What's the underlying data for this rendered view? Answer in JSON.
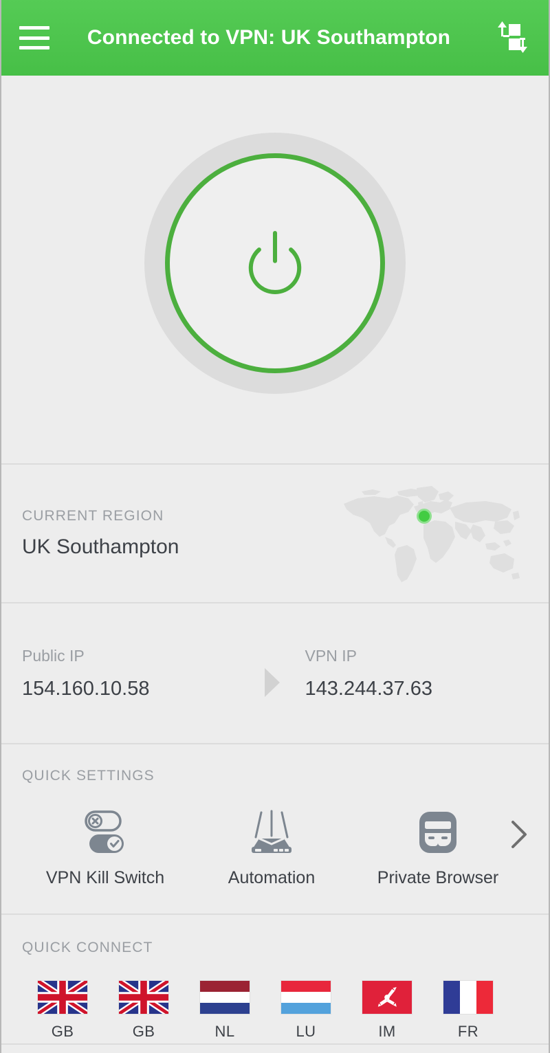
{
  "appbar": {
    "menu_icon": "hamburger-menu-icon",
    "title": "Connected to VPN: UK Southampton",
    "transfer_icon": "data-transfer-icon"
  },
  "power": {
    "icon": "power-button-icon",
    "state": "connected",
    "accent_color": "#4caf3e",
    "ring_color": "#dcdcdc"
  },
  "region": {
    "label": "CURRENT REGION",
    "value": "UK Southampton",
    "map_icon": "world-map-icon",
    "marker_color": "#43cc43"
  },
  "ip": {
    "public": {
      "label": "Public IP",
      "value": "154.160.10.58"
    },
    "vpn": {
      "label": "VPN IP",
      "value": "143.244.37.63"
    },
    "arrow_icon": "arrow-right-triangle-icon"
  },
  "quick_settings": {
    "label": "QUICK SETTINGS",
    "more_icon": "chevron-right-icon",
    "items": [
      {
        "icon": "kill-switch-toggles-icon",
        "label": "VPN Kill Switch"
      },
      {
        "icon": "router-icon",
        "label": "Automation"
      },
      {
        "icon": "incognito-mask-icon",
        "label": "Private Browser"
      }
    ]
  },
  "quick_connect": {
    "label": "QUICK CONNECT",
    "items": [
      {
        "flag": "flag-gb",
        "label": "GB"
      },
      {
        "flag": "flag-gb",
        "label": "GB"
      },
      {
        "flag": "flag-nl",
        "label": "NL"
      },
      {
        "flag": "flag-lu",
        "label": "LU"
      },
      {
        "flag": "flag-im",
        "label": "IM"
      },
      {
        "flag": "flag-fr",
        "label": "FR"
      }
    ]
  },
  "colors": {
    "brand_green": "#4fc94f",
    "accent_green": "#4caf3e",
    "text_primary": "#3d4147",
    "text_secondary": "#9a9ea3",
    "background": "#ededed",
    "divider": "#dcdcdc"
  }
}
